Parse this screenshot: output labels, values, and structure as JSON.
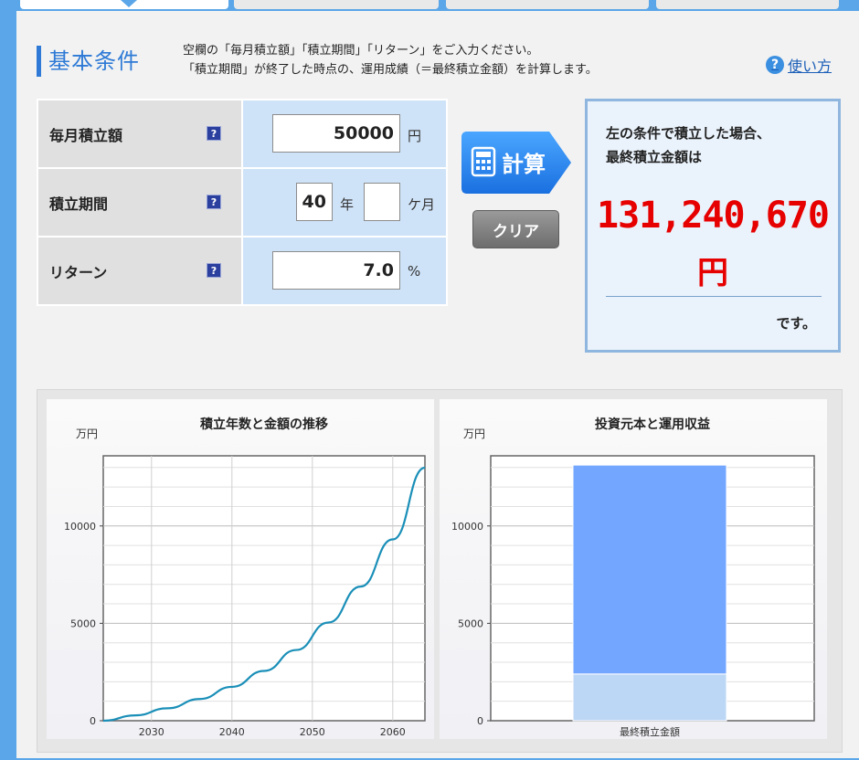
{
  "section": {
    "title": "基本条件",
    "desc_line1": "空欄の「毎月積立額」「積立期間」「リターン」をご入力ください。",
    "desc_line2": "「積立期間」が終了した時点の、運用成績（＝最終積立金額）を計算します。",
    "help_label": "使い方",
    "help_icon": "?"
  },
  "form": {
    "monthly": {
      "label": "毎月積立額",
      "value": "50000",
      "unit": "円"
    },
    "period": {
      "label": "積立期間",
      "years": "40",
      "year_unit": "年",
      "months": "",
      "month_unit": "ケ月"
    },
    "return": {
      "label": "リターン",
      "value": "7.0",
      "unit": "%"
    },
    "help_icon": "?"
  },
  "buttons": {
    "calc": "計算",
    "clear": "クリア"
  },
  "result": {
    "line1": "左の条件で積立した場合、",
    "line2": "最終積立金額は",
    "amount": "131,240,670",
    "yen": "円",
    "desu": "です。"
  },
  "colors": {
    "accent": "#2e7ad6",
    "result_red": "#e60000",
    "line": "#1a8fb8",
    "bar_top": "#73a7ff",
    "bar_bottom": "#bcd7f5"
  },
  "chart_data": [
    {
      "type": "line",
      "title": "積立年数と金額の推移",
      "ylabel": "万円",
      "x_ticks": [
        2030,
        2040,
        2050,
        2060
      ],
      "y_ticks": [
        0,
        5000,
        10000
      ],
      "xlim": [
        2024,
        2064
      ],
      "ylim": [
        0,
        13600
      ],
      "grid": true,
      "series": [
        {
          "x": [
            2024,
            2028,
            2032,
            2036,
            2040,
            2044,
            2048,
            2052,
            2056,
            2060,
            2064
          ],
          "values": [
            0,
            276,
            639,
            1114,
            1739,
            2557,
            3631,
            5040,
            6887,
            9310,
            12990
          ]
        }
      ]
    },
    {
      "type": "bar",
      "title": "投資元本と運用収益",
      "ylabel": "万円",
      "categories": [
        "最終積立金額"
      ],
      "y_ticks": [
        0,
        5000,
        10000
      ],
      "ylim": [
        0,
        13600
      ],
      "grid": true,
      "stacked": true,
      "series": [
        {
          "values": [
            2400
          ]
        },
        {
          "values": [
            10724
          ]
        }
      ]
    }
  ]
}
